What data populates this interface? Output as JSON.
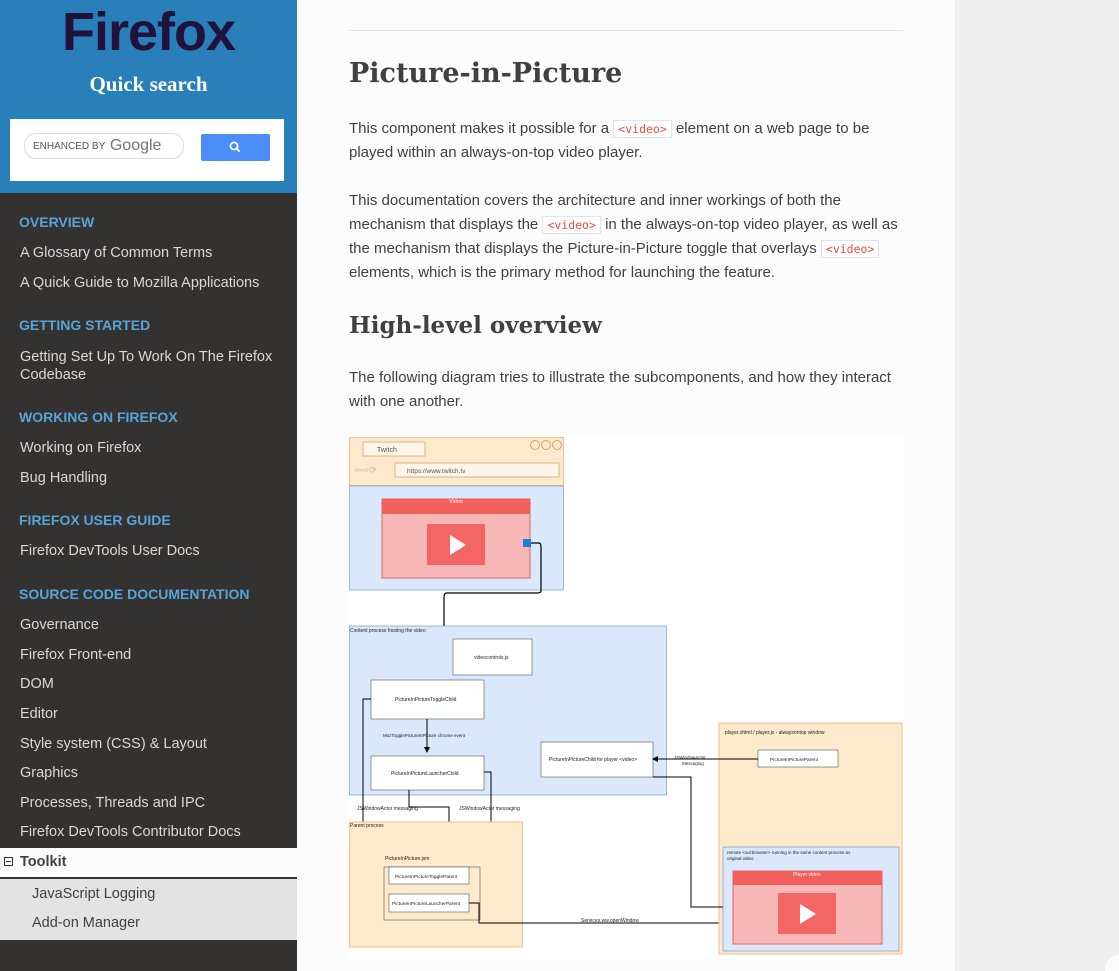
{
  "sidebar": {
    "logo": "Firefox",
    "quick_search": "Quick search",
    "search": {
      "enhanced_by": "ENHANCED BY",
      "google": "Google"
    },
    "captions": [
      "OVERVIEW",
      "GETTING STARTED",
      "WORKING ON FIREFOX",
      "FIREFOX USER GUIDE",
      "SOURCE CODE DOCUMENTATION"
    ],
    "items": [
      "A Glossary of Common Terms",
      "A Quick Guide to Mozilla Applications",
      "Getting Set Up To Work On The Firefox Codebase",
      "Working on Firefox",
      "Bug Handling",
      "Firefox DevTools User Docs",
      "Governance",
      "Firefox Front-end",
      "DOM",
      "Editor",
      "Style system (CSS) & Layout",
      "Graphics",
      "Processes, Threads and IPC",
      "Firefox DevTools Contributor Docs"
    ],
    "current": "Toolkit",
    "subitems": [
      "JavaScript Logging",
      "Add-on Manager"
    ]
  },
  "content": {
    "title": "Picture-in-Picture",
    "p1_a": "This component makes it possible for a ",
    "p1_code": "<video>",
    "p1_b": " element on a web page to be played within an always-on-top video player.",
    "p2_a": "This documentation covers the architecture and inner workings of both the mechanism that displays the ",
    "p2_code1": "<video>",
    "p2_b": " in the always-on-top video player, as well as the mechanism that displays the Picture-in-Picture toggle that overlays ",
    "p2_code2": "<video>",
    "p2_c": " elements, which is the primary method for launching the feature.",
    "h2": "High-level overview",
    "p3": "The following diagram tries to illustrate the subcomponents, and how they interact with one another."
  },
  "diagram": {
    "tab": "Twitch",
    "url": "https://www.twitch.tv",
    "video_label": "Video",
    "content_process": "Content process hosting the video",
    "videocontrols": "videocontrols.js",
    "toggle_child": "PictureInPictureToggleChild",
    "moz_event": "MozTogglePictureInPicture chrome event",
    "launcher_child": "PictureInPictureLauncherChild",
    "child_for_player": "PictureInPictureChild for player <video>",
    "jswa_messaging_1": "JSWindowActor messaging",
    "jswa_messaging_2": "JSWindowActor messaging",
    "jswa_messaging_3a": "JSWindowActor",
    "jswa_messaging_3b": "Messaging",
    "player_window": "player.xhtml / player.js - alwaysontop window",
    "pip_parent": "PictureInPictureParent",
    "parent_process": "Parent process",
    "pip_jsm": "PictureInPicture.jsm",
    "toggle_parent": "PictureInPictureToggleParent",
    "launcher_parent": "PictureInPictureLauncherParent",
    "remote_browser_a": "remote <xul:browser> running in the same content process as",
    "remote_browser_b": "original video",
    "player_video": "Player video",
    "open_window": "Services.ww.openWindow"
  }
}
